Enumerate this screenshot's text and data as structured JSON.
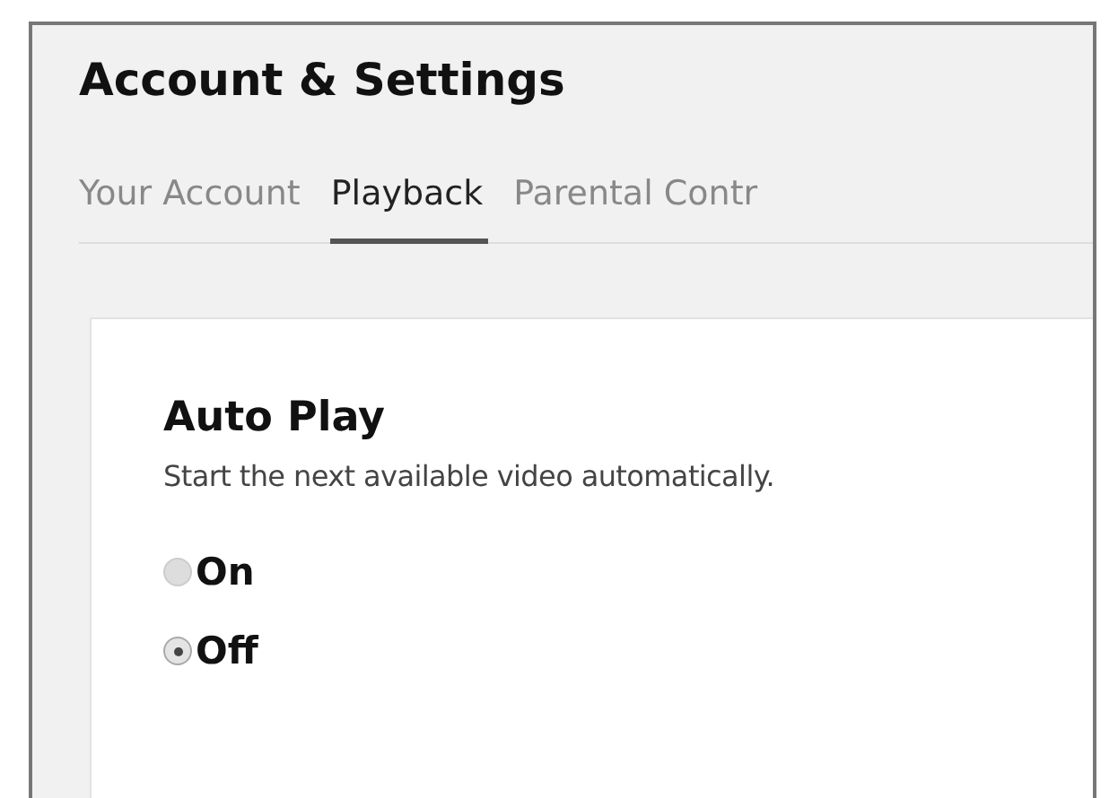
{
  "page": {
    "title": "Account & Settings"
  },
  "tabs": [
    {
      "label": "Your Account",
      "selected": false
    },
    {
      "label": "Playback",
      "selected": true
    },
    {
      "label": "Parental Contr",
      "selected": false
    }
  ],
  "section": {
    "heading": "Auto Play",
    "description": "Start the next available video automatically.",
    "options": [
      {
        "label": "On",
        "selected": false
      },
      {
        "label": "Off",
        "selected": true
      }
    ]
  }
}
